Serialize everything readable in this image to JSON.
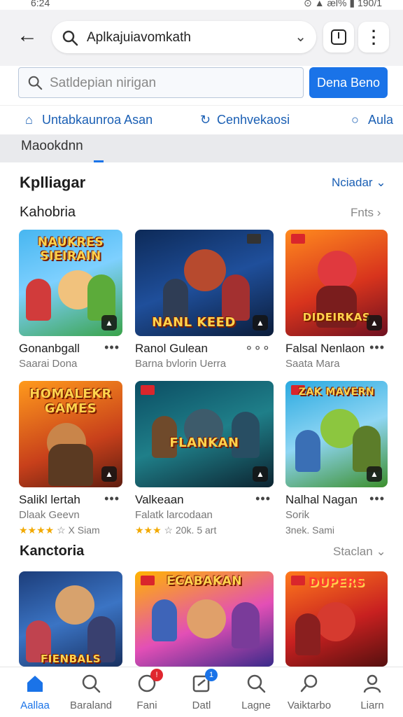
{
  "status": {
    "time": "6:24",
    "right_text": "⊙ ▲ æl% ▮ 190/1"
  },
  "header": {
    "search_text": "Aplkajuiavomkath"
  },
  "search": {
    "placeholder": "Satldepian nirigan",
    "button_label": "Dena Beno"
  },
  "tabs": [
    {
      "label": "Untabkaunroa Asan",
      "icon": "home-icon"
    },
    {
      "label": "Cenhvekaosi",
      "icon": "refresh-icon"
    },
    {
      "label": "Aula",
      "icon": "circle-icon"
    }
  ],
  "subbar": {
    "label": "Maookdnn"
  },
  "section_main": {
    "title": "Kplliagar",
    "link": "Nciadar"
  },
  "section_1": {
    "title": "Kahobria",
    "link": "Fnts",
    "apps": [
      {
        "art": "NAUKRES SIEIRAIN",
        "name": "Gonanbgall",
        "sub": "Saarai Dona",
        "more": "•••"
      },
      {
        "art": "NANL KEED",
        "name": "Ranol Gulean",
        "sub": "Barna bvlorin Uerra",
        "more": "∘∘∘"
      },
      {
        "art": "DIDEIRKAS",
        "name": "Falsal Nenlaon",
        "sub": "Saata Mara",
        "more": "•••"
      }
    ]
  },
  "section_2": {
    "apps": [
      {
        "art": "HOMALEKR GAMES",
        "name": "Salikl lertah",
        "sub": "Dlaak Geevn",
        "rating": "★★★★",
        "rating_text": "☆ X Siam",
        "more": "•••"
      },
      {
        "art": "FLANKAN",
        "name": "Valkeaan",
        "sub": "Falatk larcodaan",
        "rating": "★★★",
        "rating_text": "☆ 20k. 5 art",
        "more": "•••"
      },
      {
        "art": "ZAK MAVERN",
        "name": "Nalhal Nagan",
        "sub": "Sorik",
        "rating": "",
        "rating_text": "3nek. Sami",
        "more": "•••"
      }
    ]
  },
  "section_3": {
    "title": "Kanctoria",
    "link": "Staclan",
    "apps": [
      {
        "art": "FIENBALS"
      },
      {
        "art": "ECABAKAN"
      },
      {
        "art": "DUPERS"
      }
    ]
  },
  "bottom_nav": [
    {
      "label": "Aallaa",
      "icon": "home-icon"
    },
    {
      "label": "Baraland",
      "icon": "search-icon"
    },
    {
      "label": "Fani",
      "icon": "clock-icon",
      "badge": "!"
    },
    {
      "label": "Datl",
      "icon": "edit-icon",
      "badge": "1"
    },
    {
      "label": "Lagne",
      "icon": "search-icon"
    },
    {
      "label": "Vaiktarbo",
      "icon": "search-icon"
    },
    {
      "label": "Liarn",
      "icon": "person-icon"
    }
  ],
  "colors": {
    "accent": "#1a73e8",
    "link": "#1a5fb4",
    "star": "#f2a900",
    "badge_red": "#e0262e"
  }
}
